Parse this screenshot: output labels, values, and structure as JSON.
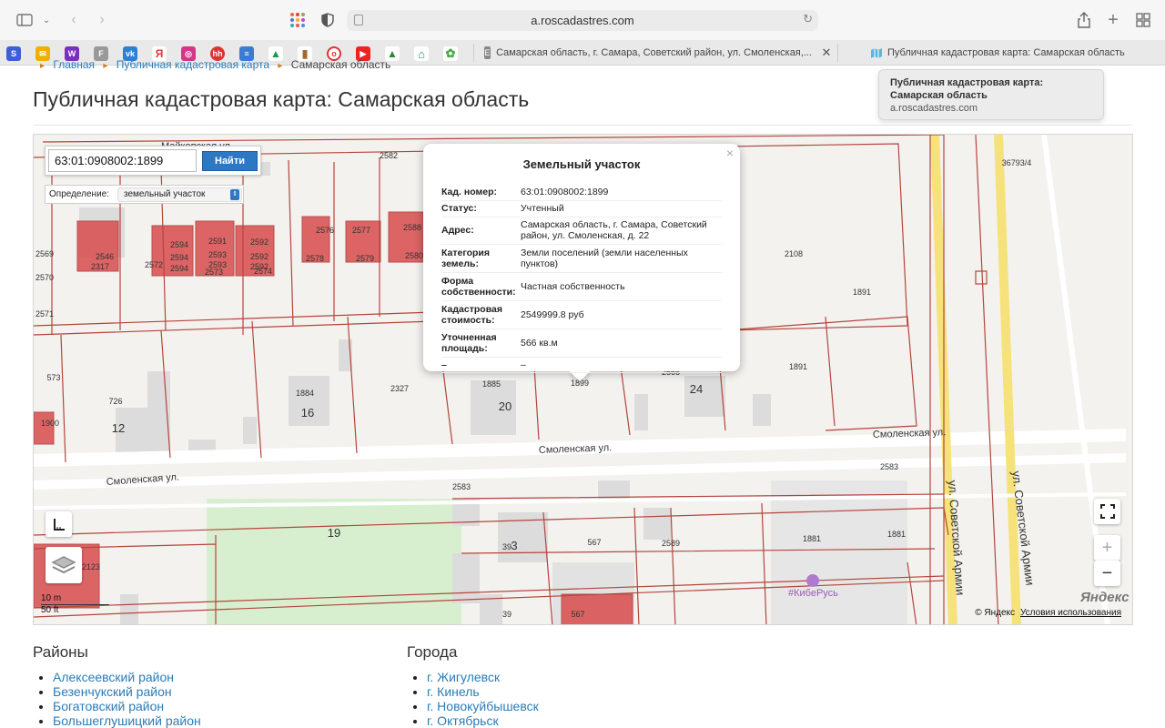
{
  "browser": {
    "url": "a.roscadastres.com",
    "tabs": [
      {
        "favicon": "E",
        "title": "Самарская область, г. Самара, Советский район, ул. Смоленская,..."
      },
      {
        "favicon": "map-icon",
        "title": "Публичная кадастровая карта: Самарская область"
      }
    ],
    "tooltip": {
      "title_line1": "Публичная кадастровая карта:",
      "title_line2": "Самарская область",
      "domain": "a.roscadastres.com"
    }
  },
  "breadcrumb": {
    "home": "Главная",
    "map": "Публичная кадастровая карта",
    "current": "Самарская область"
  },
  "page": {
    "title": "Публичная кадастровая карта: Самарская область"
  },
  "search": {
    "value": "63:01:0908002:1899",
    "button": "Найти",
    "definition_label": "Определение:",
    "definition_value": "земельный участок"
  },
  "popup": {
    "title": "Земельный участок",
    "close": "×",
    "rows": [
      {
        "k": "Кад. номер:",
        "v": "63:01:0908002:1899"
      },
      {
        "k": "Статус:",
        "v": "Учтенный"
      },
      {
        "k": "Адрес:",
        "v": "Самарская область, г. Самара, Советский район, ул. Смоленская, д. 22"
      },
      {
        "k": "Категория земель:",
        "v": "Земли поселений (земли населенных пунктов)"
      },
      {
        "k": "Форма собственности:",
        "v": "Частная собственность"
      },
      {
        "k": "Кадастровая стоимость:",
        "v": "2549999.8 руб"
      },
      {
        "k": "Уточненная площадь:",
        "v": "566 кв.м"
      },
      {
        "k": "–",
        "v": "–"
      }
    ]
  },
  "map": {
    "streets": {
      "maykopskaya": "Майкопская ул.",
      "smolenskaya": "Смоленская ул.",
      "sovetskoy_armii": "ул. Советской Армии"
    },
    "scale": {
      "metric": "10 m",
      "imperial": "50 ft"
    },
    "copyright": "© Яндекс",
    "terms": "Условия использования",
    "logo": "Яндекс",
    "poi": "#КибеРусь",
    "zoom_in": "+",
    "zoom_out": "−",
    "parcel_labels": [
      "2582",
      "36793/4",
      "2108",
      "1891",
      "1891",
      "2583",
      "2583",
      "1881",
      "1881",
      "2589",
      "567",
      "567",
      "39",
      "39",
      "19",
      "2123",
      "726",
      "573",
      "1900",
      "2569",
      "2570",
      "2571",
      "2546",
      "2317",
      "2572",
      "2594",
      "2594",
      "2594",
      "2591",
      "2593",
      "2593",
      "2573",
      "2592",
      "2592",
      "2592",
      "2574",
      "2576",
      "2578",
      "2577",
      "2579",
      "2588",
      "2580",
      "1884",
      "2327",
      "1885",
      "1899",
      "2566",
      "12",
      "16",
      "20",
      "24",
      "3"
    ]
  },
  "regions": {
    "heading": "Районы",
    "items": [
      "Алексеевский район",
      "Безенчукский район",
      "Богатовский район",
      "Большеглушицкий район"
    ]
  },
  "cities": {
    "heading": "Города",
    "items": [
      "г. Жигулевск",
      "г. Кинель",
      "г. Новокуйбышевск",
      "г. Октябрьск"
    ]
  },
  "colors": {
    "link": "#2a7cb8",
    "parcel_line": "#b5453c",
    "parcel_fill": "#d94c4c",
    "button": "#2d78c3"
  }
}
